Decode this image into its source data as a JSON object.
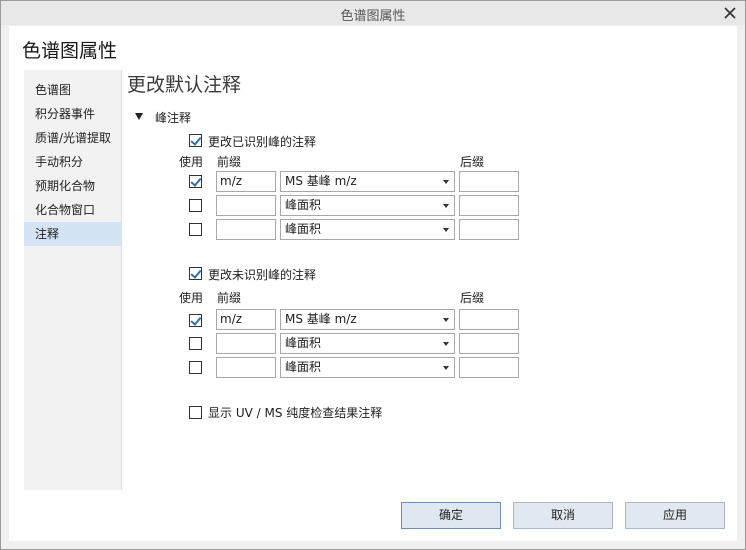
{
  "window": {
    "title": "色谱图属性",
    "close_icon": "close-icon"
  },
  "dialog_title": "色谱图属性",
  "nav": {
    "items": [
      {
        "label": "色谱图",
        "active": false
      },
      {
        "label": "积分器事件",
        "active": false
      },
      {
        "label": "质谱/光谱提取",
        "active": false
      },
      {
        "label": "手动积分",
        "active": false
      },
      {
        "label": "预期化合物",
        "active": false
      },
      {
        "label": "化合物窗口",
        "active": false
      },
      {
        "label": "注释",
        "active": true
      }
    ]
  },
  "section_title": "更改默认注释",
  "group": {
    "label": "峰注释",
    "expand_icon": "triangle-down-icon"
  },
  "identified": {
    "checkbox_label": "更改已识别峰的注释",
    "checked": true,
    "col_use": "使用",
    "col_prefix": "前缀",
    "col_suffix": "后缀",
    "rows": [
      {
        "use": true,
        "prefix": "m/z",
        "type": "MS 基峰 m/z",
        "suffix": ""
      },
      {
        "use": false,
        "prefix": "",
        "type": "峰面积",
        "suffix": ""
      },
      {
        "use": false,
        "prefix": "",
        "type": "峰面积",
        "suffix": ""
      }
    ]
  },
  "unidentified": {
    "checkbox_label": "更改未识别峰的注释",
    "checked": true,
    "col_use": "使用",
    "col_prefix": "前缀",
    "col_suffix": "后缀",
    "rows": [
      {
        "use": true,
        "prefix": "m/z",
        "type": "MS 基峰 m/z",
        "suffix": ""
      },
      {
        "use": false,
        "prefix": "",
        "type": "峰面积",
        "suffix": ""
      },
      {
        "use": false,
        "prefix": "",
        "type": "峰面积",
        "suffix": ""
      }
    ]
  },
  "purity": {
    "checkbox_label": "显示 UV / MS 纯度检查结果注释",
    "checked": false
  },
  "buttons": {
    "ok": "确定",
    "cancel": "取消",
    "apply": "应用"
  },
  "colors": {
    "accent": "#2a6fb5",
    "nav_active_bg": "#d4e4f5"
  }
}
